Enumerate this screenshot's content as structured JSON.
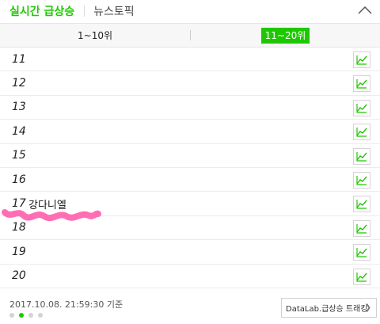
{
  "header": {
    "tab_active": "실시간 급상승",
    "tab_other": "뉴스토픽"
  },
  "range_tabs": {
    "first": "1~10위",
    "second": "11~20위",
    "active": "second"
  },
  "rows": [
    {
      "rank": "11",
      "keyword": ""
    },
    {
      "rank": "12",
      "keyword": ""
    },
    {
      "rank": "13",
      "keyword": ""
    },
    {
      "rank": "14",
      "keyword": ""
    },
    {
      "rank": "15",
      "keyword": ""
    },
    {
      "rank": "16",
      "keyword": ""
    },
    {
      "rank": "17",
      "keyword": "강다니엘"
    },
    {
      "rank": "18",
      "keyword": ""
    },
    {
      "rank": "19",
      "keyword": ""
    },
    {
      "rank": "20",
      "keyword": ""
    }
  ],
  "footer": {
    "timestamp": "2017.10.08. 21:59:30 기준",
    "datalab_label": "DataLab.급상승 트래킹",
    "page_dots": 4,
    "active_dot": 2
  },
  "colors": {
    "accent": "#1ec800",
    "scribble": "#ff6eb4"
  },
  "icons": {
    "collapse": "chevron-up-icon",
    "trend": "trend-chart-icon",
    "datalab_arrow": "chevron-right-icon"
  }
}
